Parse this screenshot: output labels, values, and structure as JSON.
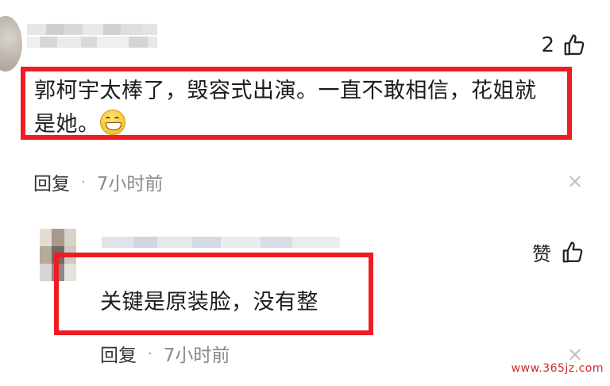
{
  "comment1": {
    "like_count": "2",
    "text_line1": "郭柯宇太棒了，毁容式出演。一直不敢相信，花姐就",
    "text_line2": "是她。",
    "emoji": "grinning-face-icon",
    "reply_label": "回复",
    "separator": "·",
    "time": "7小时前",
    "close_glyph": "×"
  },
  "comment2": {
    "like_label": "赞",
    "text": "关键是原装脸，没有整",
    "reply_label": "回复",
    "separator": "·",
    "time": "7小时前",
    "close_glyph": "×"
  },
  "watermark": "www.365jz.com",
  "colors": {
    "highlight_red": "#ee1d23",
    "text_dark": "#1c1c1c",
    "meta_gray": "#8a8a8a",
    "close_gray": "#bdbdbd"
  }
}
